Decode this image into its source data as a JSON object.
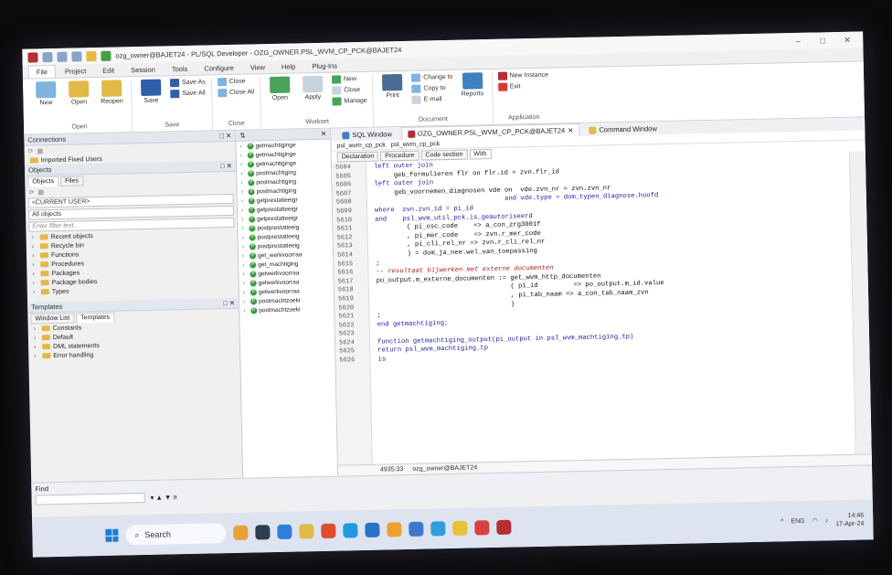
{
  "titlebar": {
    "title": "ozg_owner@BAJET24 - PL/SQL Developer - OZG_OWNER.PSL_WVM_CP_PCK@BAJET24",
    "min": "–",
    "max": "□",
    "close": "✕"
  },
  "ribbon_tabs": [
    "File",
    "Project",
    "Edit",
    "Session",
    "Tools",
    "Configure",
    "View",
    "Help",
    "Plug-Ins"
  ],
  "ribbon": {
    "open_group": {
      "label": "Open",
      "new": "New",
      "open": "Open",
      "reopen": "Reopen"
    },
    "save_group": {
      "label": "Save",
      "save": "Save",
      "save_as": "Save As",
      "save_all": "Save All"
    },
    "close_group": {
      "label": "Close",
      "close": "Close",
      "close_all": "Close All"
    },
    "workset_group": {
      "label": "Workset",
      "open": "Open",
      "apply": "Apply",
      "new": "New",
      "close": "Close",
      "manage": "Manage"
    },
    "document_group": {
      "label": "Document",
      "print": "Print",
      "change_to": "Change to",
      "copy_to": "Copy to",
      "email": "E-mail",
      "reports": "Reports"
    },
    "application_group": {
      "label": "Application",
      "new_instance": "New Instance",
      "exit": "Exit"
    }
  },
  "connections": {
    "title": "Connections",
    "item": "Imported Fixed Users"
  },
  "objects": {
    "title": "Objects",
    "tabs": [
      "Objects",
      "Files"
    ],
    "user_select": "<CURRENT USER>",
    "filter_select": "All objects",
    "filter_placeholder": "Enter filter text...",
    "tree": [
      "Recent objects",
      "Recycle bin",
      "Functions",
      "Procedures",
      "Packages",
      "Package bodies",
      "Types"
    ]
  },
  "templates": {
    "title": "Templates",
    "tabs": [
      "Window List",
      "Templates"
    ],
    "tree": [
      "Constants",
      "Default",
      "DML statements",
      "Error handling"
    ]
  },
  "object_list": [
    "getmachtiginge",
    "getmachtiginge",
    "getmachtiginge",
    "postmachtiging",
    "postmachtiging",
    "postmachtiging",
    "getprestatieeigr",
    "getprestatieeigr",
    "getprestatieeigr",
    "postprestatieeig",
    "postprestatieeig",
    "postprestatieeig",
    "get_werkvoorraa",
    "get_machtiging",
    "getwerkvoorraa",
    "getwerkvoorraa",
    "getwerkvoorraa",
    "postmachtzoeki",
    "postmachtzoeki"
  ],
  "doc_tabs": [
    "SQL Window",
    "OZG_OWNER.PSL_WVM_CP_PCK@BAJET24",
    "Command Window"
  ],
  "sub_doc_tabs": [
    "psl_wvm_cp_pck",
    "psl_wvm_cp_pck"
  ],
  "code_tabs": [
    "Declaration",
    "Procedure",
    "Code section",
    "With"
  ],
  "line_numbers": [
    "5604",
    "5605",
    "5606",
    "5607",
    "5608",
    "5609",
    "5610",
    "5611",
    "5612",
    "5613",
    "5614",
    "5615",
    "5616",
    "5617",
    "5618",
    "5619",
    "5620",
    "5621",
    "5622",
    "5623",
    "5624",
    "5625",
    "5626"
  ],
  "code_lines": [
    "left outer join",
    "     geb_formulieren flr on flr.id = zvn.flr_id",
    "left outer join",
    "     geb_voornemen_diagnosen vde on  vde.zvn_nr = zvn.zvn_nr",
    "                                 and vde.type = dom_typen_diagnose.hoofd",
    "where  zvn.zvn_id = pi_id",
    "and    psl_wvm_util_pck.is_geautoriseerd",
    "        ( pi_osc_code    => a_con_zrg3001f",
    "        , pi_mer_code    => zvn.r_mer_code",
    "        , pi_cli_rel_nr => zvn.r_cli_rel_nr",
    "        ) = dom_ja_nee.wel_van_toepassing",
    ";",
    "-- resultaat bijwerken met externe documenten",
    "po_output.m_externe_documenten := get_wvm_http_documenten",
    "                                  ( pi_id         => po_output.m_id.value",
    "                                  , pi_tab_naam => a_con_tab_naam_zvn",
    "                                  )",
    ";",
    "end getmachtiging;",
    "",
    "function getmachtiging_output(pi_output in psl_wvm_machtiging_tp)",
    "return psl_wvm_machtiging_tp",
    "is"
  ],
  "status": {
    "position": "4935:33",
    "connection": "ozg_owner@BAJET24"
  },
  "find": {
    "label": "Find"
  },
  "taskbar": {
    "search": "Search",
    "lang": "ENG",
    "time": "14:46",
    "date": "17-Apr-24"
  },
  "colors": {
    "accent": "#1c7fd6",
    "highlight": "#9fe09a",
    "keyword": "#1b1bb3",
    "comment": "#b22222"
  }
}
